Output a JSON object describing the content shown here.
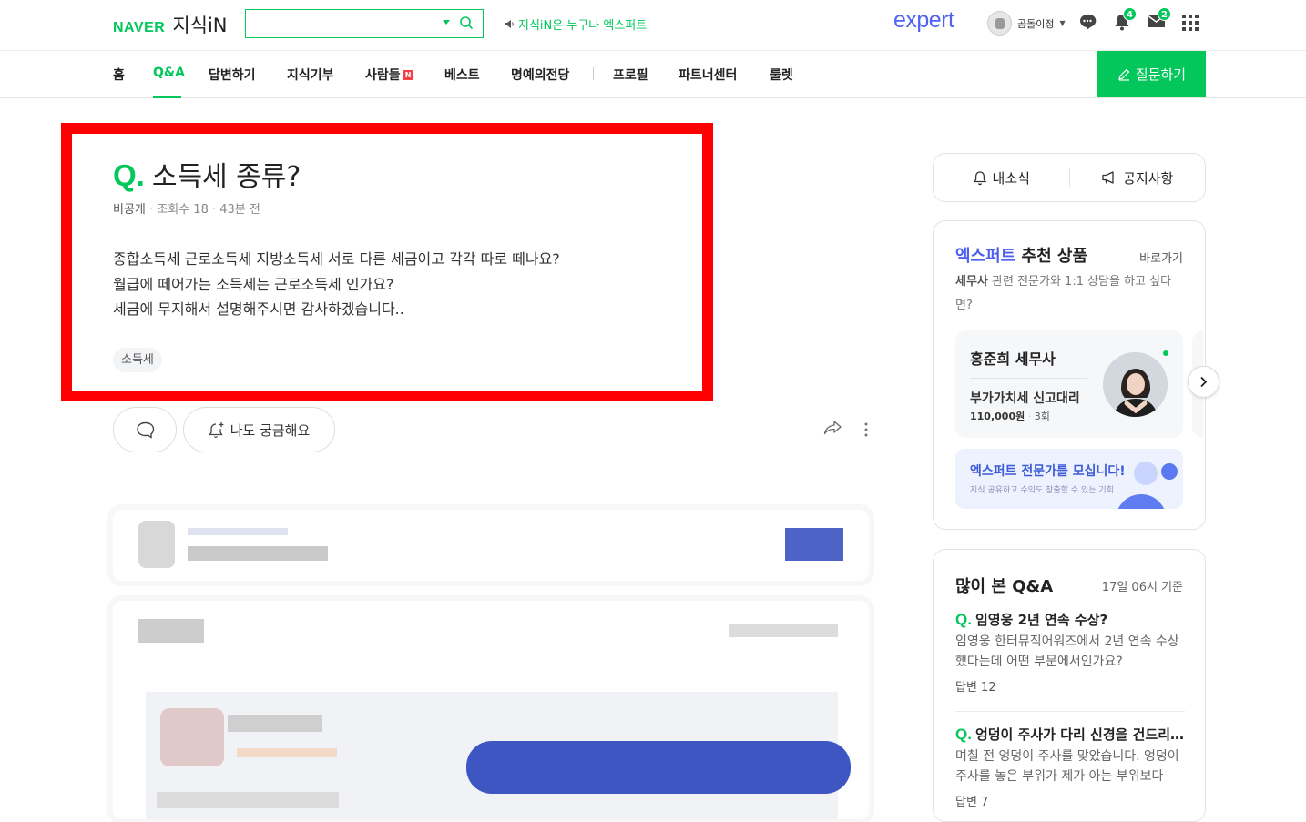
{
  "header": {
    "brand": "NAVER",
    "service": "지식iN",
    "notice": "지식iN은 누구나 엑스퍼트",
    "expert_logo": "expert",
    "username": "곰돌이정",
    "chat_badge": "",
    "alarm_badge": "4",
    "mail_badge": "2"
  },
  "nav": {
    "items": [
      "홈",
      "Q&A",
      "답변하기",
      "지식기부",
      "사람들",
      "베스트",
      "명예의전당",
      "프로필",
      "파트너센터",
      "룰렛"
    ],
    "new_badge": "N",
    "ask_button": "질문하기"
  },
  "question": {
    "q_mark": "Q.",
    "title": "소득세 종류?",
    "visibility": "비공개",
    "views": "조회수 18",
    "time": "43분 전",
    "body": [
      "종합소득세 근로소득세 지방소득세 서로 다른 세금이고 각각 따로 떼나요?",
      "월급에 떼어가는 소득세는 근로소득세 인가요?",
      "세금에 무지해서 설명해주시면 감사하겠습니다.."
    ],
    "tag": "소득세",
    "curious_label": "나도 궁금해요"
  },
  "sidebar": {
    "notif_label": "내소식",
    "notice_label": "공지사항",
    "expert_title_blue": "엑스퍼트",
    "expert_title_rest": " 추천 상품",
    "expert_link": "바로가기",
    "expert_desc_bold": "세무사",
    "expert_desc_rest": " 관련 전문가와 1:1 상담을 하고 싶다면?",
    "pro_name": "홍준희 세무사",
    "pro_service": "부가가치세 신고대리",
    "pro_price": "110,000원",
    "pro_count": "3회",
    "recruit_title": "엑스퍼트 전문가를 모십니다!",
    "recruit_sub": "지식 공유하고 수익도 창출할 수 있는 기회",
    "popular_title": "많이 본 Q&A",
    "popular_date": "17일 06시 기준",
    "popular": [
      {
        "q": "Q.",
        "title": "임영웅 2년 연속 수상?",
        "desc": "임영웅 한터뮤직어워즈에서 2년 연속 수상했다는데 어떤 부문에서인가요?",
        "answers": "답변 12"
      },
      {
        "q": "Q.",
        "title": "엉덩이 주사가 다리 신경을 건드리나요?",
        "desc": "며칠 전 엉덩이 주사를 맞았습니다. 엉덩이 주사를 놓은 부위가 제가 아는 부위보다",
        "answers": "답변 7"
      }
    ]
  },
  "colors": {
    "accent": "#03c75a",
    "expert_blue": "#4d5ef0",
    "highlight": "#ff0000"
  }
}
